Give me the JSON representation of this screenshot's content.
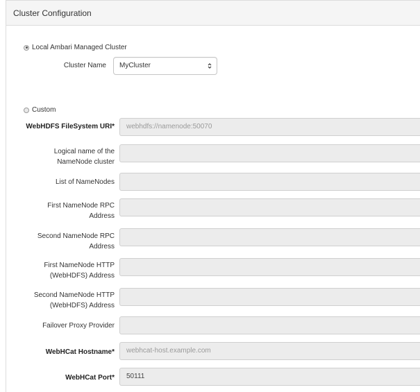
{
  "panel": {
    "title": "Cluster Configuration"
  },
  "local": {
    "label": "Local Ambari Managed Cluster",
    "checked": true,
    "cluster_name_label": "Cluster Name",
    "cluster_name_value": "MyCluster"
  },
  "custom": {
    "label": "Custom",
    "checked": false
  },
  "fields": {
    "webhdfs_uri": {
      "label": "WebHDFS FileSystem URI*",
      "placeholder": "webhdfs://namenode:50070",
      "value": ""
    },
    "logical_name": {
      "label1": "Logical name of the",
      "label2": "NameNode cluster",
      "value": ""
    },
    "list_namenodes": {
      "label": "List of NameNodes",
      "value": ""
    },
    "first_rpc": {
      "label1": "First NameNode RPC",
      "label2": "Address",
      "value": ""
    },
    "second_rpc": {
      "label1": "Second NameNode RPC",
      "label2": "Address",
      "value": ""
    },
    "first_http": {
      "label1": "First NameNode HTTP",
      "label2": "(WebHDFS) Address",
      "value": ""
    },
    "second_http": {
      "label1": "Second NameNode HTTP",
      "label2": "(WebHDFS) Address",
      "value": ""
    },
    "failover": {
      "label": "Failover Proxy Provider",
      "value": ""
    },
    "webhcat_host": {
      "label": "WebHCat Hostname*",
      "placeholder": "webhcat-host.example.com",
      "value": ""
    },
    "webhcat_port": {
      "label": "WebHCat Port*",
      "value": "50111"
    }
  }
}
